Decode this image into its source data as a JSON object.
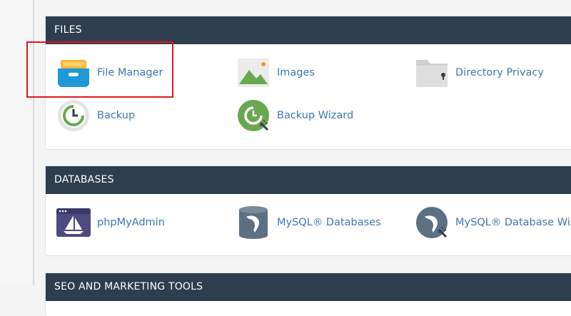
{
  "sections": {
    "files": {
      "title": "FILES",
      "items": {
        "file_manager": "File Manager",
        "images": "Images",
        "directory_privacy": "Directory Privacy",
        "backup": "Backup",
        "backup_wizard": "Backup Wizard"
      }
    },
    "databases": {
      "title": "DATABASES",
      "items": {
        "phpmyadmin": "phpMyAdmin",
        "mysql_databases": "MySQL® Databases",
        "mysql_database_wizard": "MySQL® Database Wizard"
      }
    },
    "seo": {
      "title": "SEO AND MARKETING TOOLS"
    }
  },
  "colors": {
    "header_bg": "#2e3e4e",
    "link": "#3c78b4",
    "highlight": "#e0161c"
  },
  "icons": {
    "file_manager": "file-drawer-icon",
    "images": "landscape-image-icon",
    "directory_privacy": "locked-folder-icon",
    "backup": "backup-clock-icon",
    "backup_wizard": "backup-wizard-icon",
    "phpmyadmin": "sailboat-window-icon",
    "mysql_databases": "dolphin-database-icon",
    "mysql_database_wizard": "dolphin-wizard-icon"
  }
}
